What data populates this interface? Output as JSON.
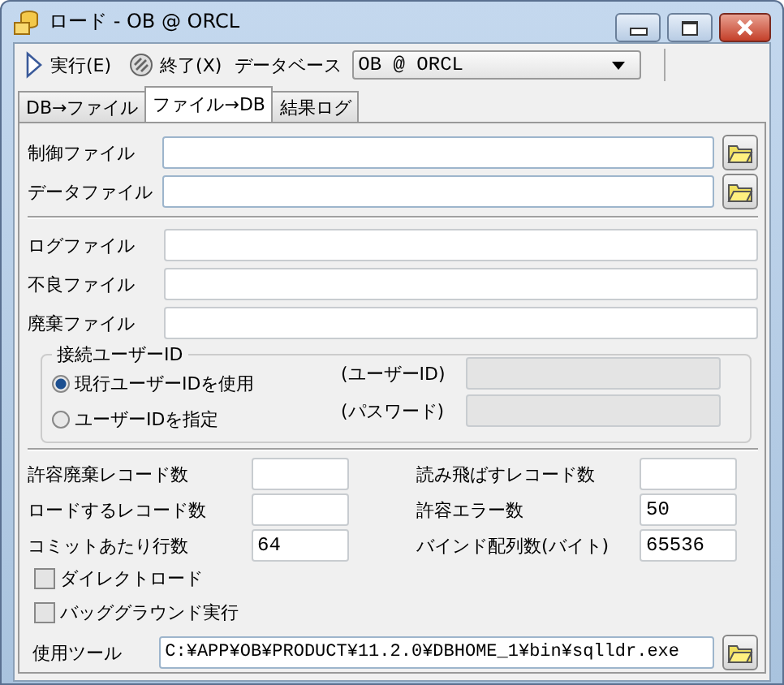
{
  "window": {
    "title": "ロード - OB @ ORCL"
  },
  "toolbar": {
    "run": "実行(E)",
    "exit": "終了(X)",
    "database_label": "データベース",
    "database": "OB @ ORCL"
  },
  "tabs": [
    {
      "label": "DB→ファイル",
      "selected": false
    },
    {
      "label": "ファイル→DB",
      "selected": true
    },
    {
      "label": "結果ログ",
      "selected": false
    }
  ],
  "input_files": [
    {
      "label": "制御ファイル"
    },
    {
      "label": "データファイル"
    }
  ],
  "output_files": [
    {
      "label": "ログファイル"
    },
    {
      "label": "不良ファイル"
    },
    {
      "label": "廃棄ファイル"
    }
  ],
  "user_id": {
    "legend": "接続ユーザーID",
    "options": [
      {
        "label": "現行ユーザーIDを使用",
        "selected": true
      },
      {
        "label": "ユーザーIDを指定",
        "selected": false
      }
    ],
    "fields": [
      {
        "label": "(ユーザーID)",
        "disabled": true
      },
      {
        "label": "(パスワード)",
        "disabled": true
      }
    ]
  },
  "counts": [
    {
      "label": "許容廃棄レコード数"
    },
    {
      "label": "読み飛ばすレコード数"
    },
    {
      "label": "ロードするレコード数"
    },
    {
      "label": "許容エラー数",
      "value": "50"
    },
    {
      "label": "コミットあたり行数",
      "value": "64"
    },
    {
      "label": "バインド配列数(バイト)",
      "value": "65536"
    }
  ],
  "checkboxes": [
    {
      "label": "ダイレクトロード",
      "checked": false
    },
    {
      "label": "バッググラウンド実行",
      "checked": false
    }
  ],
  "tool": {
    "label": "使用ツール",
    "value": "C:¥APP¥OB¥PRODUCT¥11.2.0¥DBHOME_1¥bin¥sqlldr.exe"
  }
}
